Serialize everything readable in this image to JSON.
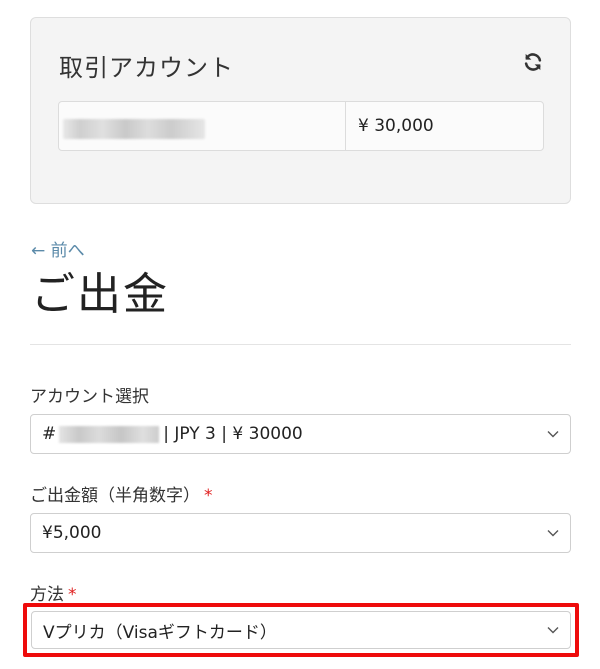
{
  "account_card": {
    "title": "取引アカウント",
    "balance": "¥ 30,000",
    "refresh_icon": "refresh-icon"
  },
  "nav": {
    "back_label": "← 前へ"
  },
  "page": {
    "title": "ご出金"
  },
  "form": {
    "account_select": {
      "label": "アカウント選択",
      "value_prefix": "#",
      "value_suffix": "| JPY 3 | ¥ 30000"
    },
    "amount_select": {
      "label": "ご出金額（半角数字）",
      "required_mark": "*",
      "value": "¥5,000"
    },
    "method_select": {
      "label": "方法",
      "required_mark": "*",
      "value": "Vプリカ（Visaギフトカード）"
    }
  },
  "colors": {
    "link": "#5b8aa9",
    "required": "#e02020",
    "highlight": "#ee0b0b"
  }
}
